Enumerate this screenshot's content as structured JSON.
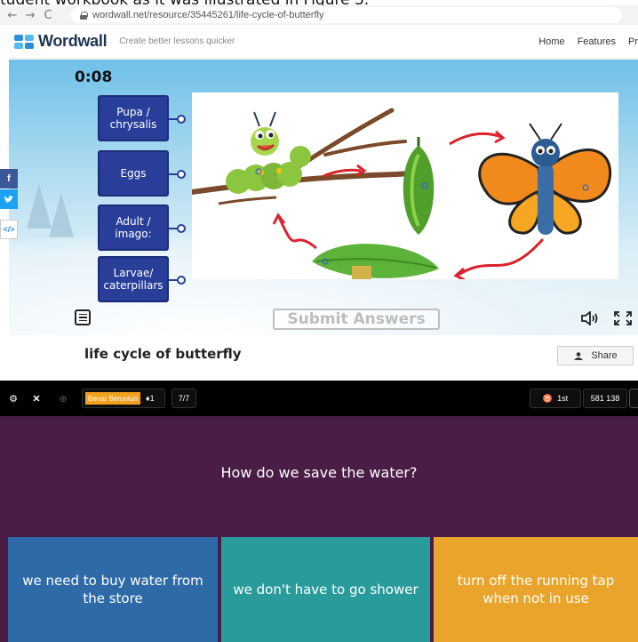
{
  "document": {
    "caption": "tudent workbook as it was illustrated in Figure 3."
  },
  "browser": {
    "url": "wordwall.net/resource/35445261/life-cycle-of-butterfly"
  },
  "site": {
    "logo": "Wordwall",
    "tagline": "Create better lessons quicker",
    "nav": [
      "Home",
      "Features",
      "Pr"
    ]
  },
  "game": {
    "timer": "0:08",
    "tiles": [
      "Pupa / chrysalis",
      "Eggs",
      "Adult / imago:",
      "Larvae/ caterpillars"
    ],
    "submit_label": "Submit Answers",
    "activity_title": "life cycle of butterfly",
    "share_label": "Share"
  },
  "social": {
    "facebook": "f",
    "embed": "</>"
  },
  "quiz": {
    "player_name": "Benar Beruntun",
    "streak": "1",
    "question_progress": "7/7",
    "rank": "1st",
    "score": "581 138",
    "question": "How do we save the water?",
    "answers": [
      "we need to buy water from the store",
      "we don't have to go shower",
      "turn off the running tap when not in use"
    ]
  },
  "colors": {
    "tile": "#283e99",
    "quiz_bg": "#4a1d47",
    "answer_1": "#2f6aa8",
    "answer_2": "#2a9b9b",
    "answer_3": "#e9a52b"
  }
}
